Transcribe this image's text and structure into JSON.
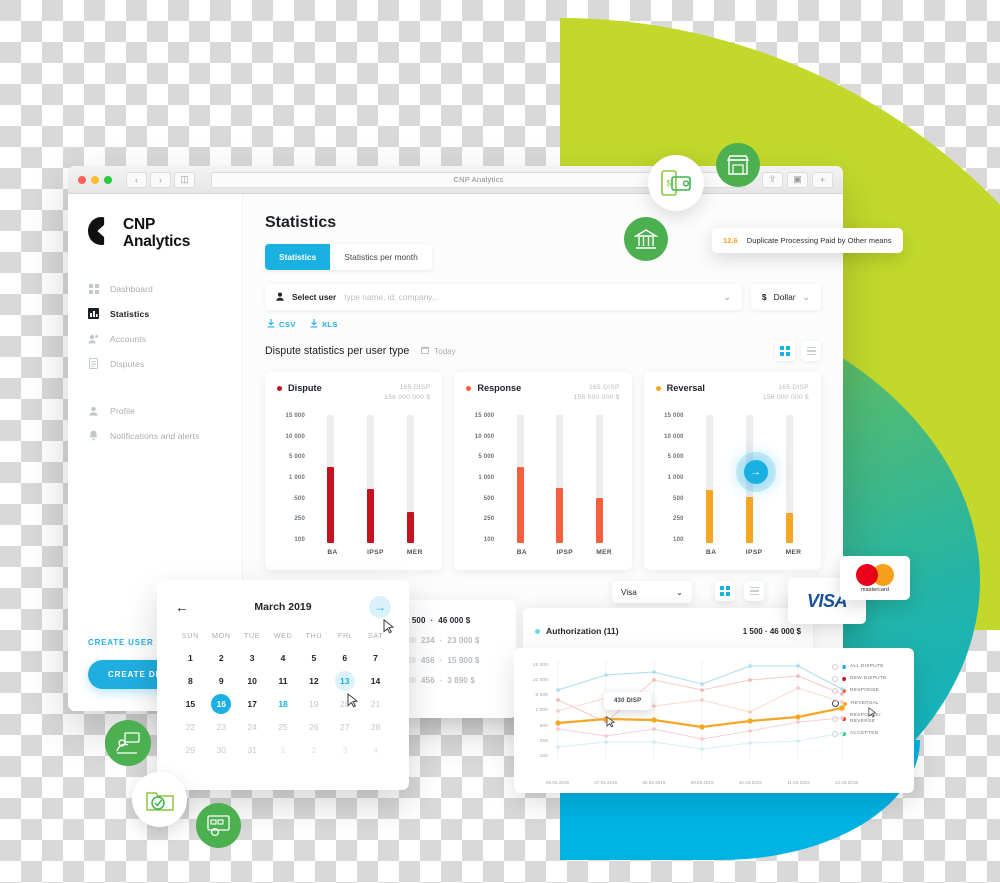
{
  "browser": {
    "url_title": "CNP Analytics",
    "reload_icon": "reload-icon",
    "back_icon": "chevron-left-icon",
    "forward_icon": "chevron-right-icon",
    "sidebar_toggle_icon": "panel-icon",
    "share_icon": "share-icon",
    "tabs_icon": "copy-icon",
    "new_tab_icon": "plus-icon"
  },
  "sidebar": {
    "brand_line1": "CNP",
    "brand_line2": "Analytics",
    "items": [
      {
        "label": "Dashboard",
        "icon": "grid-icon",
        "active": false
      },
      {
        "label": "Statistics",
        "icon": "bar-chart-icon",
        "active": true
      },
      {
        "label": "Accounts",
        "icon": "users-icon",
        "active": false
      },
      {
        "label": "Disputes",
        "icon": "document-icon",
        "active": false
      }
    ],
    "items2": [
      {
        "label": "Profile",
        "icon": "user-icon",
        "active": false
      },
      {
        "label": "Notifications and alerts",
        "icon": "bell-icon",
        "active": false
      }
    ],
    "create_user": "CREATE USER",
    "create_dispute": "CREATE DISPUTE"
  },
  "main": {
    "page_title": "Statistics",
    "tabs": [
      {
        "label": "Statistics",
        "active": true
      },
      {
        "label": "Statistics per month",
        "active": false
      }
    ],
    "select_user": {
      "icon": "user-icon",
      "label": "Select user",
      "placeholder": "type name, id, company...",
      "chevron": "chevron-down-icon"
    },
    "currency": {
      "symbol": "$",
      "value": "Dollar",
      "chevron": "chevron-down-icon"
    },
    "exports": [
      {
        "label": "CSV",
        "icon": "download-icon"
      },
      {
        "label": "XLS",
        "icon": "download-icon"
      }
    ],
    "section_title": "Dispute statistics per user type",
    "today": {
      "label": "Today",
      "icon": "calendar-icon"
    },
    "view_grid_icon": "grid-view-icon",
    "view_list_icon": "list-view-icon"
  },
  "chart_data": [
    {
      "type": "bar",
      "title": "Dispute",
      "color": "#c4121f",
      "meta_count": "165 DISP",
      "meta_amount": "156 000 000 $",
      "categories": [
        "BA",
        "IPSP",
        "MER"
      ],
      "values": [
        1300,
        600,
        290
      ],
      "ytick_labels": [
        "15 000",
        "10 000",
        "5 000",
        "1 000",
        "500",
        "250",
        "100"
      ],
      "ylabel": "",
      "xlabel": "",
      "grid": false,
      "legend": "top-left"
    },
    {
      "type": "bar",
      "title": "Response",
      "color": "#f4603e",
      "meta_count": "165 DISP",
      "meta_amount": "156 000 000 $",
      "categories": [
        "BA",
        "IPSP",
        "MER"
      ],
      "values": [
        1300,
        620,
        480
      ],
      "ytick_labels": [
        "15 000",
        "10 000",
        "5 000",
        "1 000",
        "500",
        "250",
        "100"
      ],
      "ylabel": "",
      "xlabel": "",
      "grid": false,
      "legend": "top-left"
    },
    {
      "type": "bar",
      "title": "Reversal",
      "color": "#f5a623",
      "meta_count": "165 DISP",
      "meta_amount": "156 000 000 $",
      "categories": [
        "BA",
        "IPSP",
        "MER"
      ],
      "values": [
        560,
        480,
        280
      ],
      "ytick_labels": [
        "15 000",
        "10 000",
        "5 000",
        "1 000",
        "500",
        "250",
        "100"
      ],
      "ylabel": "",
      "xlabel": "",
      "grid": false,
      "legend": "top-left",
      "annotation": {
        "icon": "arrow-right-icon",
        "at_category": "IPSP"
      }
    },
    {
      "type": "line",
      "title": "Authorization (11)",
      "meta": "1 500  ·  46 000 $",
      "x": [
        "06.03.2019",
        "07.03.2019",
        "08.03.2019",
        "09.03.2019",
        "10.03.2019",
        "11.03.2019",
        "12.03.2019"
      ],
      "ytick_labels": [
        "15 000",
        "10 000",
        "5 000",
        "1 000",
        "500",
        "250",
        "100"
      ],
      "tooltip": "430 DISP",
      "grid": true,
      "legend_position": "right",
      "series": [
        {
          "name": "ALL DISPUTE",
          "color": "#9fd9ef",
          "values": [
            4000,
            9500,
            10500,
            7000,
            12500,
            12500,
            4500
          ]
        },
        {
          "name": "NEW DISPUTE",
          "color": "#f6c6c6",
          "values": [
            1000,
            4500,
            7000,
            4000,
            7000,
            7700,
            3000
          ]
        },
        {
          "name": "RESPONSE",
          "color": "#f9d7d0",
          "values": [
            500,
            1900,
            1900,
            1000,
            600,
            4000,
            2000
          ]
        },
        {
          "name": "REVERSAL",
          "color": "#f5a623",
          "values": [
            320,
            430,
            420,
            260,
            400,
            460,
            700
          ]
        },
        {
          "name": "RESPONSE/REVERSE",
          "color": "#f7cccc",
          "values": [
            230,
            170,
            240,
            140,
            250,
            330,
            460
          ]
        },
        {
          "name": "ACCEPTED",
          "color": "#d6eef7",
          "values": [
            90,
            105,
            105,
            80,
            100,
            115,
            150
          ]
        }
      ]
    }
  ],
  "legend_items": [
    {
      "label": "ALL DISPUTE",
      "color": "#22aee0",
      "selected": false
    },
    {
      "label": "NEW DISPUTE",
      "color": "#c4121f",
      "selected": false
    },
    {
      "label": "RESPONSE",
      "color": "#f4603e",
      "selected": false
    },
    {
      "label": "REVERSAL",
      "color": "#f5a623",
      "selected": true
    },
    {
      "label": "RESPONSE/ REVERSE",
      "color": "#e8422c",
      "selected": false
    },
    {
      "label": "ACCEPTED",
      "color": "#2bbf8a",
      "selected": false
    }
  ],
  "calendar": {
    "title": "March 2019",
    "prev_icon": "arrow-left-icon",
    "next_icon": "arrow-right-icon",
    "dow": [
      "SUN",
      "MON",
      "TUE",
      "WED",
      "THU",
      "FRI",
      "SAT"
    ],
    "weeks": [
      [
        {
          "d": "1"
        },
        {
          "d": "2"
        },
        {
          "d": "3"
        },
        {
          "d": "4"
        },
        {
          "d": "5"
        },
        {
          "d": "6"
        },
        {
          "d": "7"
        }
      ],
      [
        {
          "d": "8"
        },
        {
          "d": "9"
        },
        {
          "d": "10"
        },
        {
          "d": "11"
        },
        {
          "d": "12"
        },
        {
          "d": "13",
          "state": "hov"
        },
        {
          "d": "14"
        }
      ],
      [
        {
          "d": "15"
        },
        {
          "d": "16",
          "state": "sel"
        },
        {
          "d": "17"
        },
        {
          "d": "18",
          "state": "blue"
        },
        {
          "d": "19",
          "state": "muted"
        },
        {
          "d": "20",
          "state": "muted"
        },
        {
          "d": "21",
          "state": "muted"
        }
      ],
      [
        {
          "d": "22",
          "state": "muted"
        },
        {
          "d": "23",
          "state": "muted"
        },
        {
          "d": "24",
          "state": "muted"
        },
        {
          "d": "25",
          "state": "muted"
        },
        {
          "d": "26",
          "state": "muted"
        },
        {
          "d": "27",
          "state": "muted"
        },
        {
          "d": "28",
          "state": "muted"
        }
      ],
      [
        {
          "d": "29",
          "state": "muted"
        },
        {
          "d": "30",
          "state": "muted"
        },
        {
          "d": "31",
          "state": "muted"
        },
        {
          "d": "1",
          "state": "faint"
        },
        {
          "d": "2",
          "state": "faint"
        },
        {
          "d": "3",
          "state": "faint"
        },
        {
          "d": "4",
          "state": "faint"
        }
      ]
    ]
  },
  "list_card": {
    "rows": [
      {
        "count": "1 500",
        "sep": "·",
        "amount": "46 000 $",
        "dim": false
      },
      {
        "count": "234",
        "sep": "·",
        "amount": "23 000 $",
        "dim": true
      },
      {
        "count": "456",
        "sep": "·",
        "amount": "15 900 $",
        "dim": true
      },
      {
        "count": "456",
        "sep": "·",
        "amount": "3 890 $",
        "dim": true
      }
    ]
  },
  "auth_panel": {
    "title": "Authorization (11)",
    "meta": "1 500  ·  46 000 $",
    "dot_color": "#6fd5e8"
  },
  "visa_filter": {
    "value": "Visa",
    "chevron": "chevron-down-icon"
  },
  "toast": {
    "number": "12.6",
    "message": "Duplicate Processing Paid by Other means"
  },
  "card_logos": {
    "visa": "VISA",
    "mastercard": "mastercard"
  },
  "floating_icons": [
    {
      "name": "mobile-wallet-icon",
      "style": "white"
    },
    {
      "name": "store-icon",
      "style": "green"
    },
    {
      "name": "bank-icon",
      "style": "green"
    },
    {
      "name": "payment-terminal-icon",
      "style": "green"
    },
    {
      "name": "folder-check-icon",
      "style": "white"
    },
    {
      "name": "settings-dashboard-icon",
      "style": "green"
    }
  ]
}
